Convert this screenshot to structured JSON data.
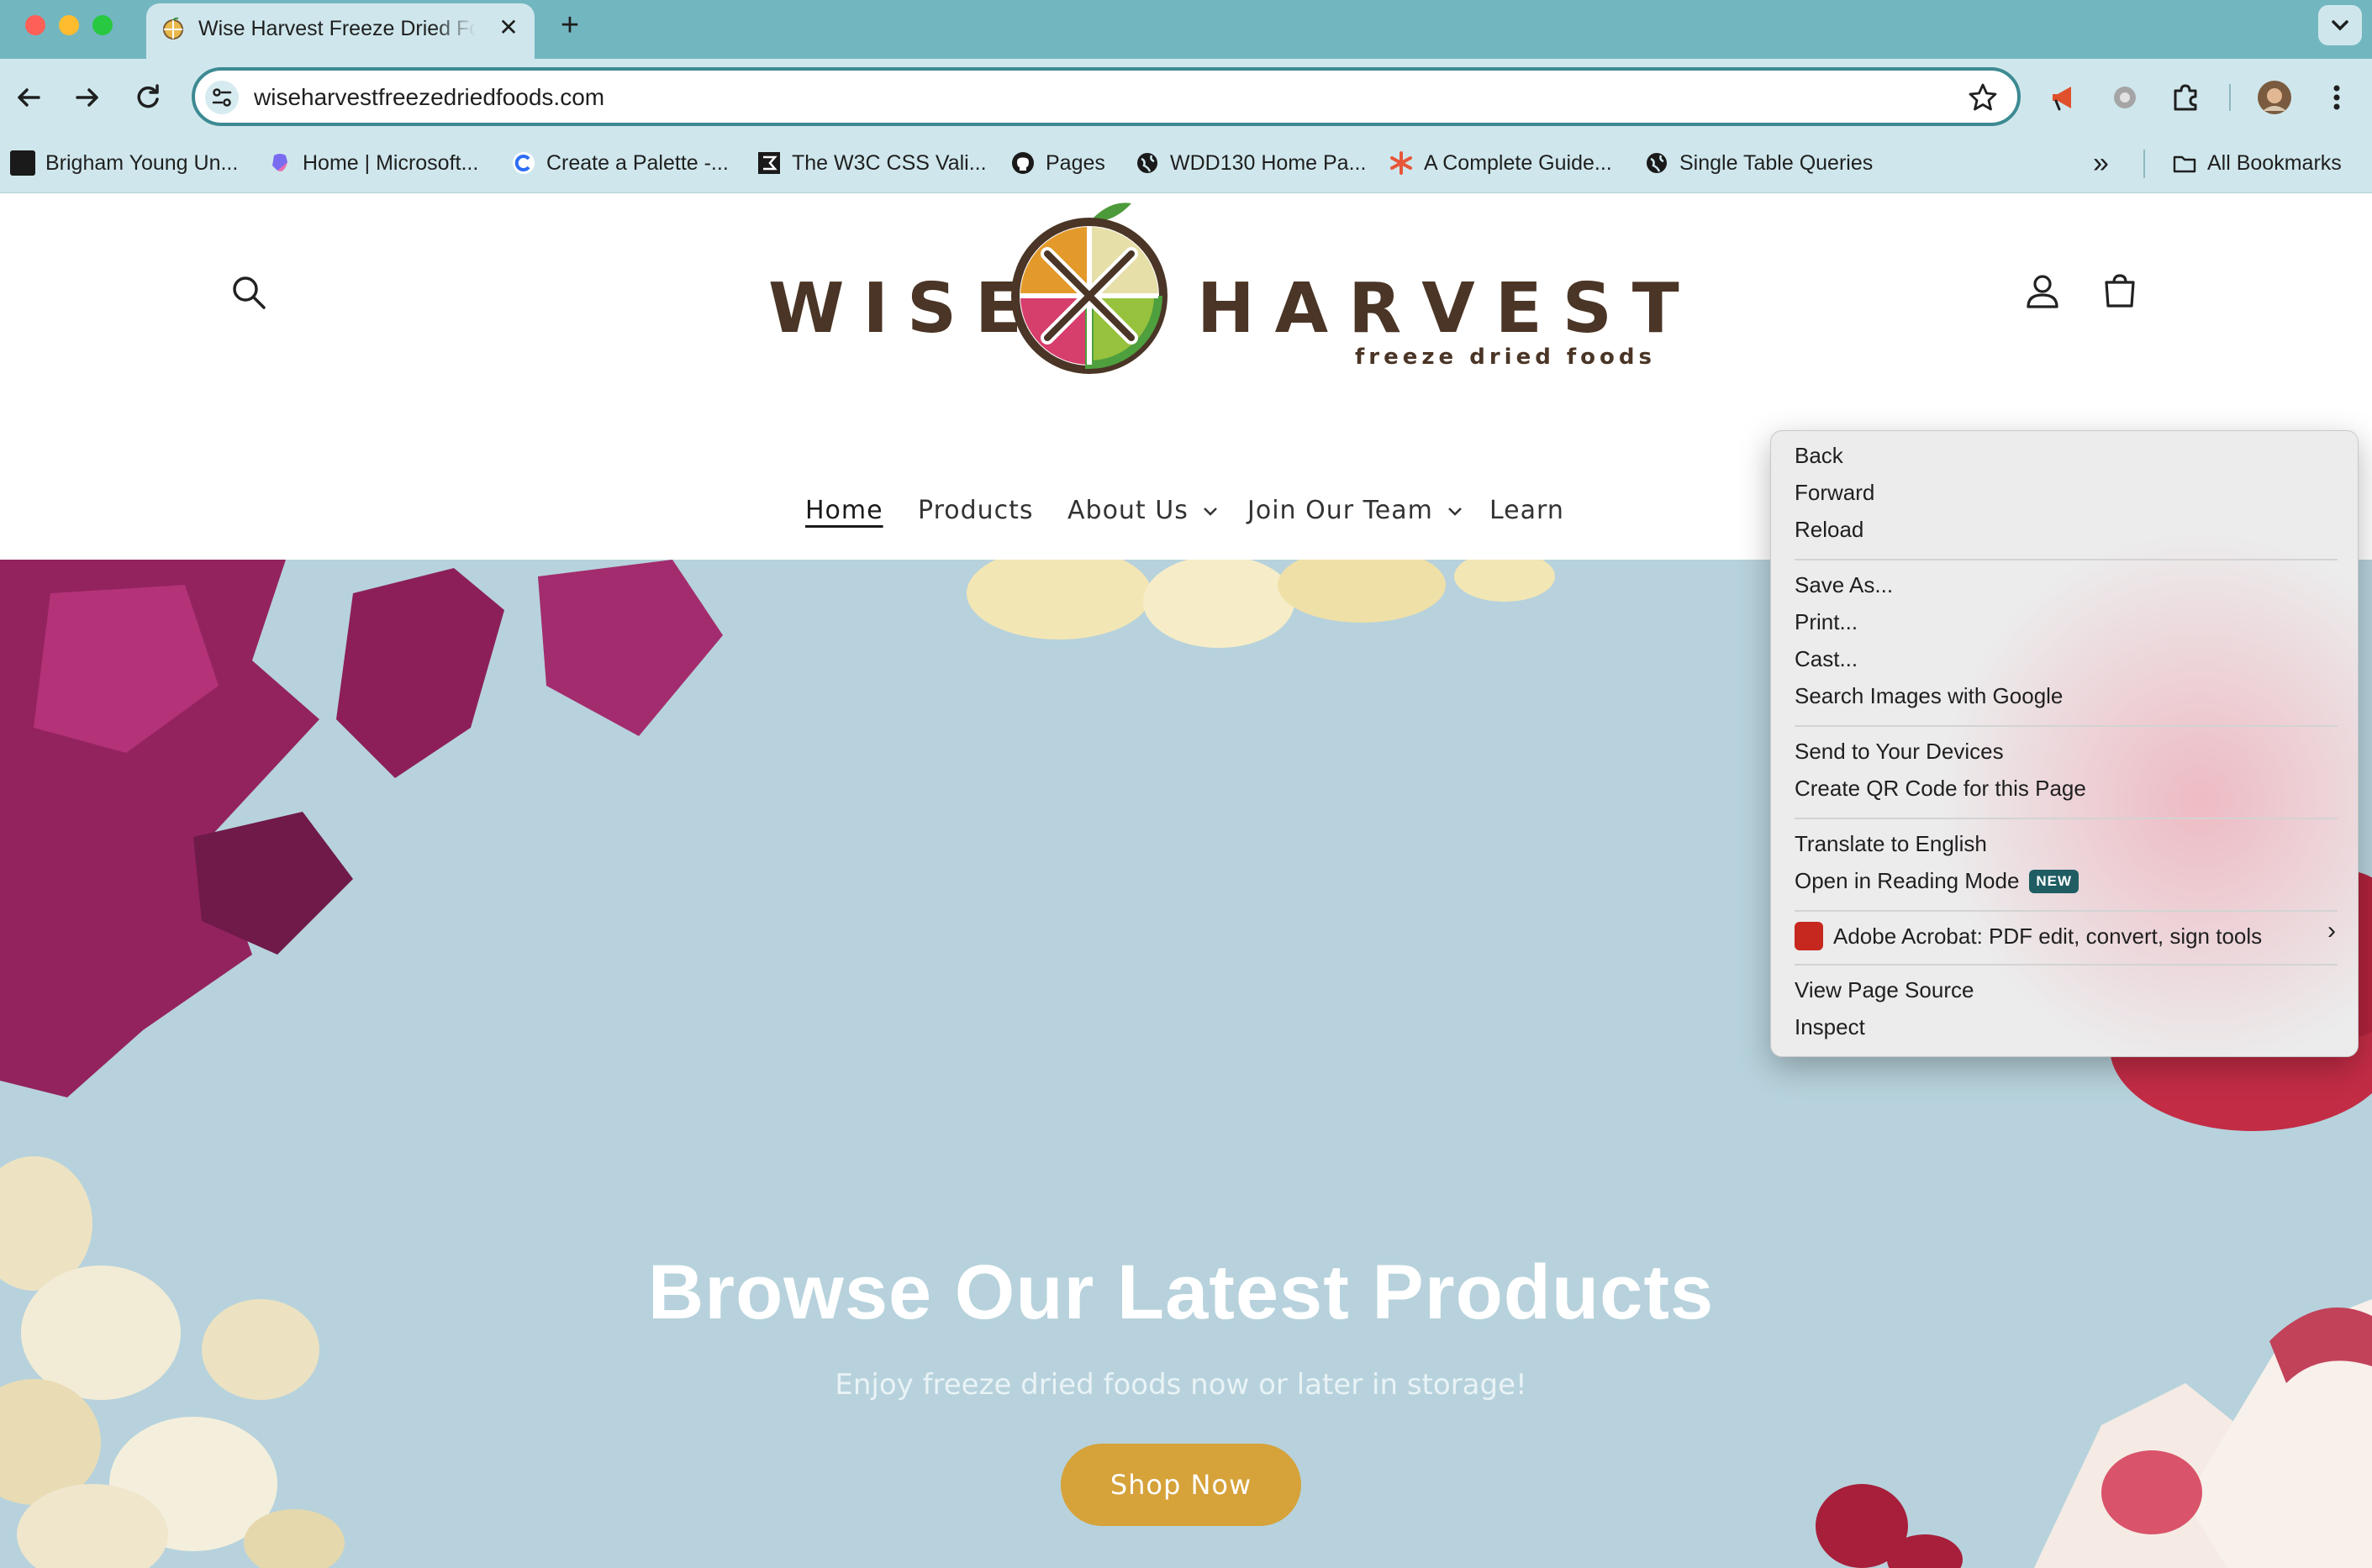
{
  "browser": {
    "tab": {
      "title": "Wise Harvest Freeze Dried Foods",
      "close_label": "✕"
    },
    "new_tab_label": "+",
    "omnibox": {
      "url": "wiseharvestfreezedriedfoods.com"
    },
    "bookmarks": [
      {
        "label": "Brigham Young Un...",
        "icon": "byu-icon"
      },
      {
        "label": "Home | Microsoft...",
        "icon": "microsoft-copilot-icon"
      },
      {
        "label": "Create a Palette -...",
        "icon": "coolors-icon"
      },
      {
        "label": "The W3C CSS Vali...",
        "icon": "w3c-icon"
      },
      {
        "label": "Pages",
        "icon": "github-icon"
      },
      {
        "label": "WDD130 Home Pa...",
        "icon": "globe-icon"
      },
      {
        "label": "A Complete Guide...",
        "icon": "asterisk-icon"
      },
      {
        "label": "Single Table Queries",
        "icon": "globe-icon"
      }
    ],
    "bookmarks_overflow": "»",
    "all_bookmarks_label": "All Bookmarks"
  },
  "site": {
    "logo": {
      "word1": "WISE",
      "word2": "HARVEST",
      "tagline": "freeze dried foods"
    },
    "nav": [
      {
        "label": "Home",
        "active": true,
        "dropdown": false
      },
      {
        "label": "Products",
        "active": false,
        "dropdown": false
      },
      {
        "label": "About Us",
        "active": false,
        "dropdown": true
      },
      {
        "label": "Join Our Team",
        "active": false,
        "dropdown": true
      },
      {
        "label": "Learn",
        "active": false,
        "dropdown": false
      }
    ],
    "hero": {
      "title": "Browse Our Latest Products",
      "subtitle": "Enjoy freeze dried foods now or later in storage!",
      "button": "Shop Now"
    }
  },
  "context_menu": {
    "groups": [
      [
        "Back",
        "Forward",
        "Reload"
      ],
      [
        "Save As...",
        "Print...",
        "Cast...",
        "Search Images with Google"
      ],
      [
        "Send to Your Devices",
        "Create QR Code for this Page"
      ],
      [
        "Translate to English",
        "Open in Reading Mode"
      ],
      [
        "Adobe Acrobat: PDF edit, convert, sign tools"
      ],
      [
        "View Page Source",
        "Inspect"
      ]
    ],
    "new_badge": "NEW",
    "submenu_arrow": "›"
  },
  "colors": {
    "chrome_tabstrip": "#72b6c0",
    "chrome_toolbar": "#cfe7ec",
    "hero_bg": "#b7d2dc",
    "shop_button": "#d6a23a",
    "logo_brown": "#4a3526"
  }
}
